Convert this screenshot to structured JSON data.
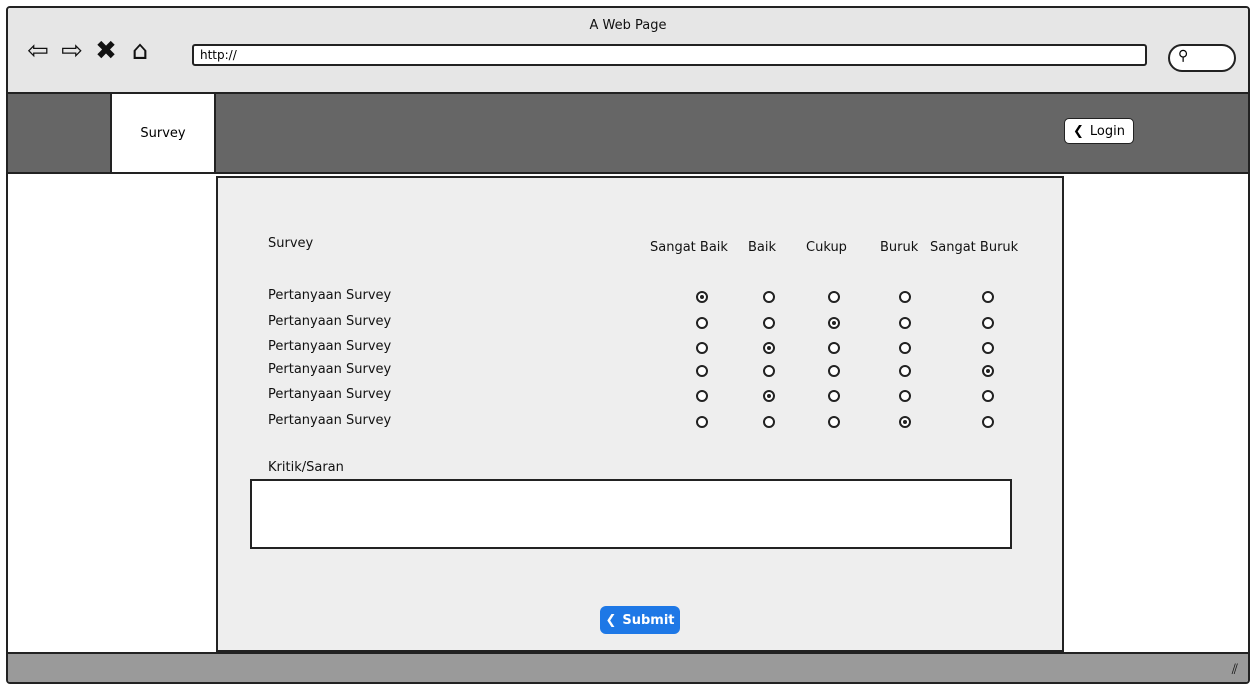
{
  "window": {
    "title": "A Web Page"
  },
  "browser": {
    "address": "http://",
    "nav_icons": [
      "back-icon",
      "forward-icon",
      "close-icon",
      "home-icon"
    ],
    "search_icon": "search-icon"
  },
  "nav": {
    "tab_label": "Survey",
    "login_label": "Login"
  },
  "survey": {
    "title": "Survey",
    "columns": [
      "Sangat Baik",
      "Baik",
      "Cukup",
      "Buruk",
      "Sangat Buruk"
    ],
    "questions": [
      {
        "label": "Pertanyaan Survey",
        "selected": 0
      },
      {
        "label": "Pertanyaan Survey",
        "selected": 2
      },
      {
        "label": "Pertanyaan Survey",
        "selected": 1
      },
      {
        "label": "Pertanyaan Survey",
        "selected": 4
      },
      {
        "label": "Pertanyaan Survey",
        "selected": 1
      },
      {
        "label": "Pertanyaan Survey",
        "selected": 3
      }
    ],
    "feedback_label": "Kritik/Saran",
    "feedback_value": "",
    "submit_label": "Submit"
  },
  "colors": {
    "nav_bg": "#666666",
    "content_bg": "#eeeeee",
    "accent": "#1e78e6"
  }
}
